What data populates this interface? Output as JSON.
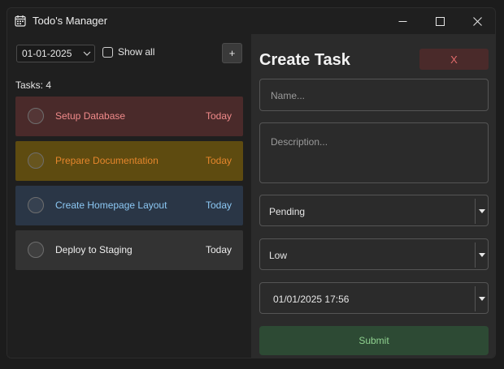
{
  "window": {
    "title": "Todo's Manager"
  },
  "toolbar": {
    "date_filter": "01-01-2025",
    "show_all_label": "Show all",
    "show_all_checked": false,
    "add_label": "+"
  },
  "tasks": {
    "count_label": "Tasks: 4",
    "items": [
      {
        "name": "Setup Database",
        "due": "Today",
        "color": "#f08a8a"
      },
      {
        "name": "Prepare Documentation",
        "due": "Today",
        "color": "#e5862c"
      },
      {
        "name": "Create Homepage Layout",
        "due": "Today",
        "color": "#8cc8f4"
      },
      {
        "name": "Deploy to Staging",
        "due": "Today",
        "color": "#eeeeee"
      }
    ]
  },
  "form": {
    "title": "Create Task",
    "close_label": "X",
    "name_placeholder": "Name...",
    "description_placeholder": "Description...",
    "status": "Pending",
    "priority": "Low",
    "datetime": "01/01/2025 17:56",
    "submit_label": "Submit"
  },
  "colors": {
    "submit_bg": "#2d4a34",
    "close_bg": "#4a2a2a"
  }
}
